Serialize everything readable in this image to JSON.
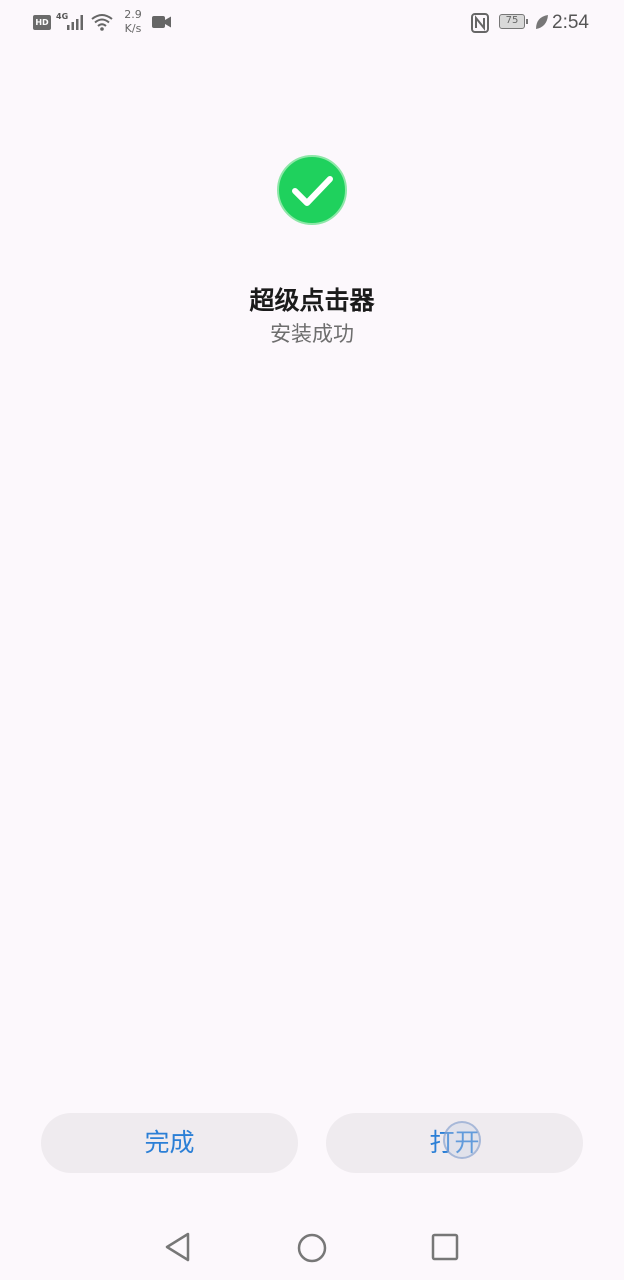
{
  "status_bar": {
    "hd_label": "HD",
    "network_label": "4G",
    "speed_value": "2.9",
    "speed_unit": "K/s",
    "battery_level": "75",
    "time": "2:54",
    "icons": [
      "hd-icon",
      "signal-icon",
      "wifi-icon",
      "camera-icon",
      "nfc-icon",
      "battery-icon",
      "leaf-icon"
    ]
  },
  "main": {
    "status_icon": "check-circle-icon",
    "app_name": "超级点击器",
    "status_text": "安装成功",
    "accent_color": "#1fd15d"
  },
  "actions": {
    "done_label": "完成",
    "open_label": "打开",
    "button_text_color": "#2b7fd6"
  },
  "nav_bar": {
    "icons": [
      "back-icon",
      "home-icon",
      "recent-apps-icon"
    ]
  }
}
